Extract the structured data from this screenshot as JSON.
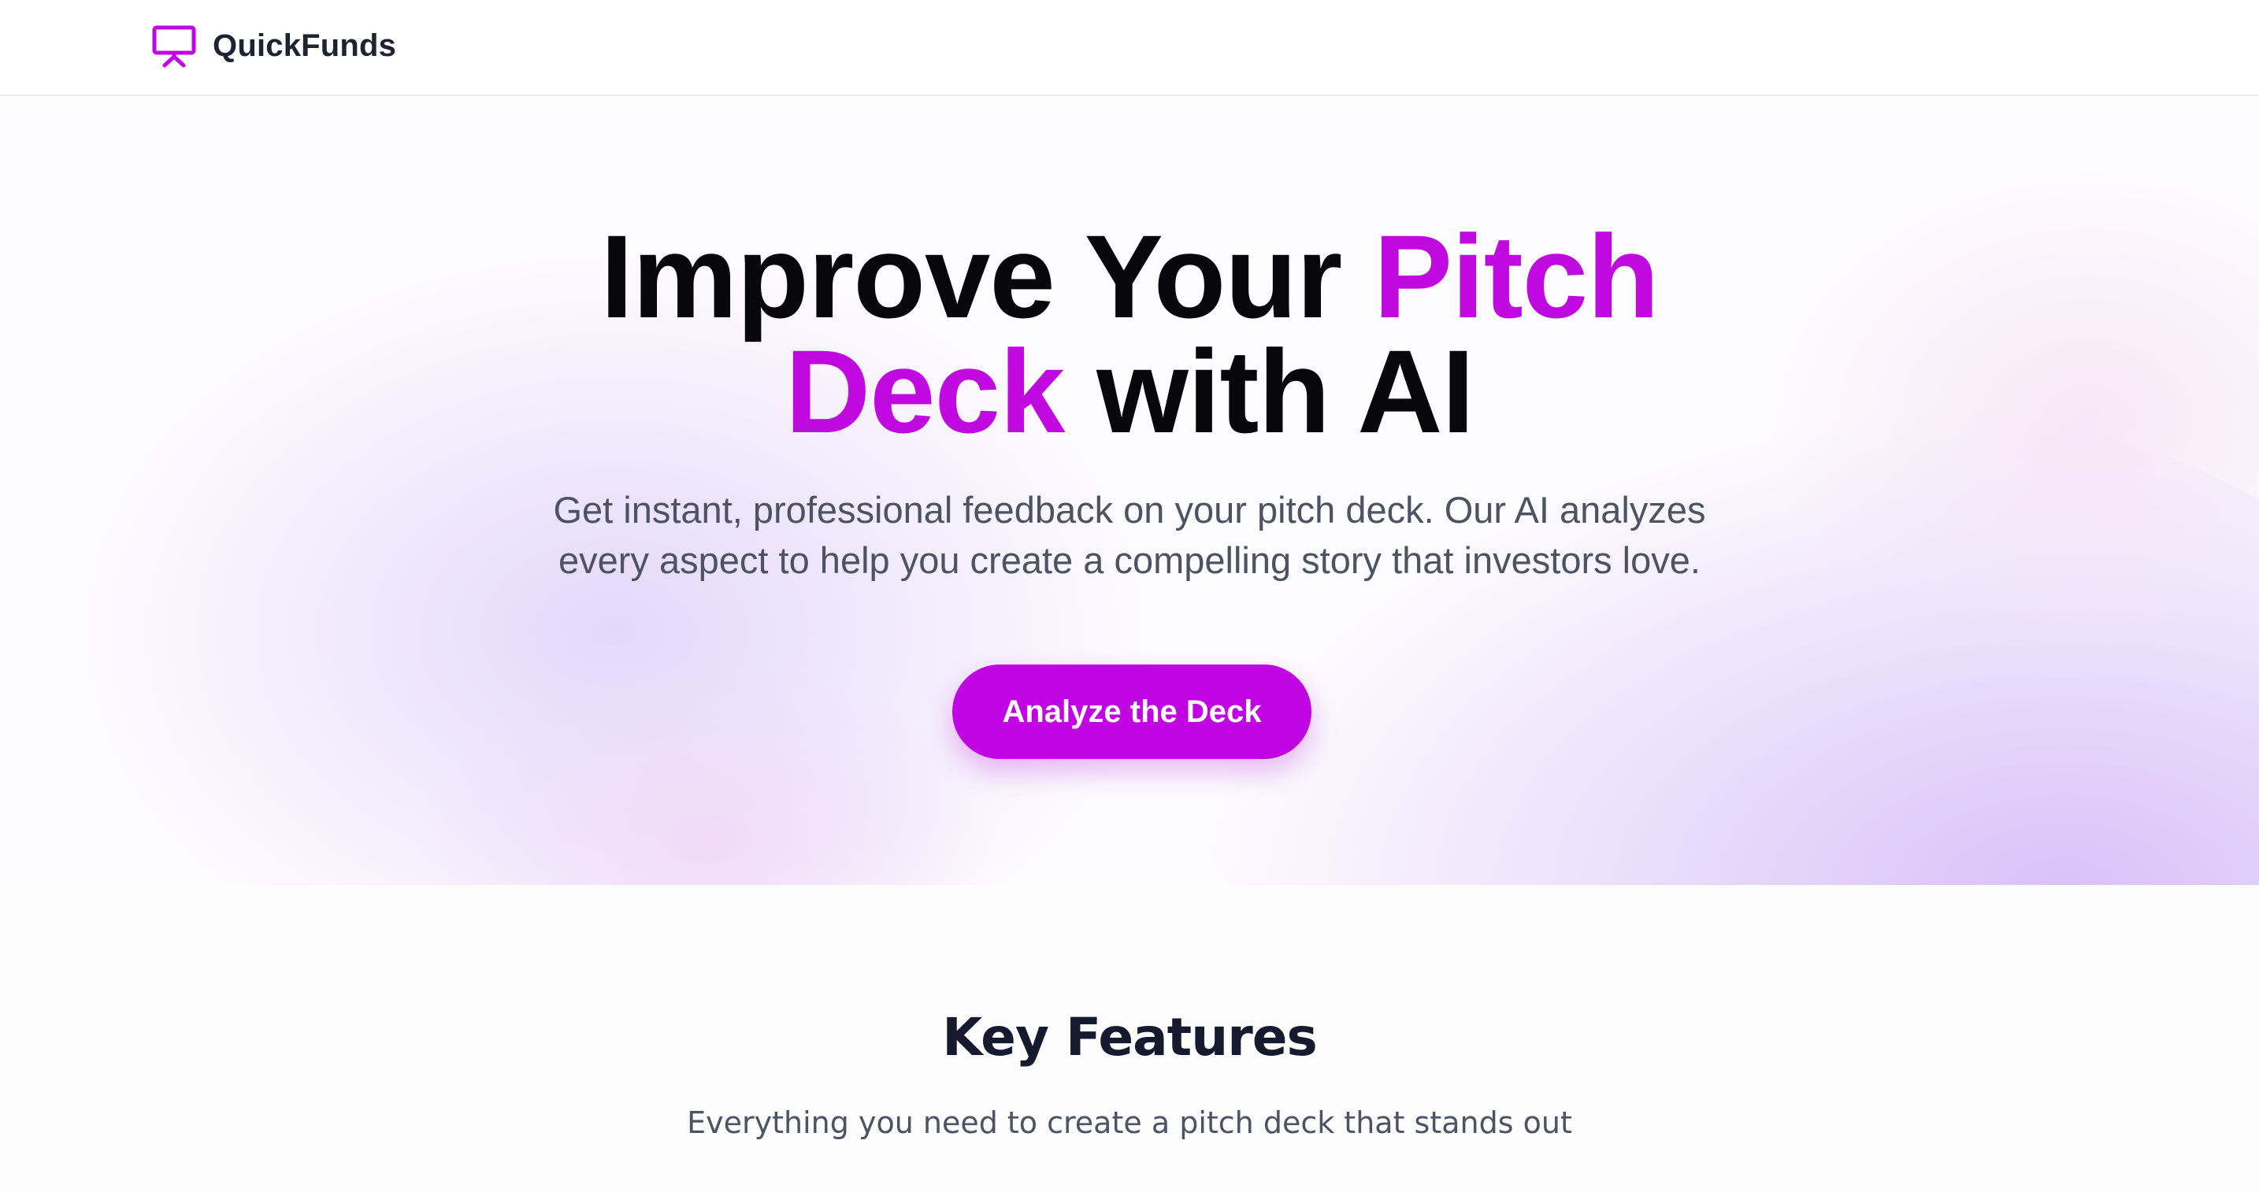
{
  "header": {
    "brand_name": "QuickFunds",
    "brand_icon": "presentation-icon"
  },
  "hero": {
    "title_line1_plain": "Improve Your ",
    "title_line1_accent": "Pitch",
    "title_line2_accent": "Deck",
    "title_line2_plain": " with AI",
    "subtitle_line1": "Get instant, professional feedback on your pitch deck. Our AI analyzes",
    "subtitle_line2": "every aspect to help you create a compelling story that investors love.",
    "cta_label": "Analyze the Deck"
  },
  "features": {
    "title": "Key Features",
    "subtitle": "Everything you need to create a pitch deck that stands out"
  },
  "colors": {
    "accent": "#c104e2",
    "heading": "#08080c",
    "body_text": "#4d5363"
  }
}
